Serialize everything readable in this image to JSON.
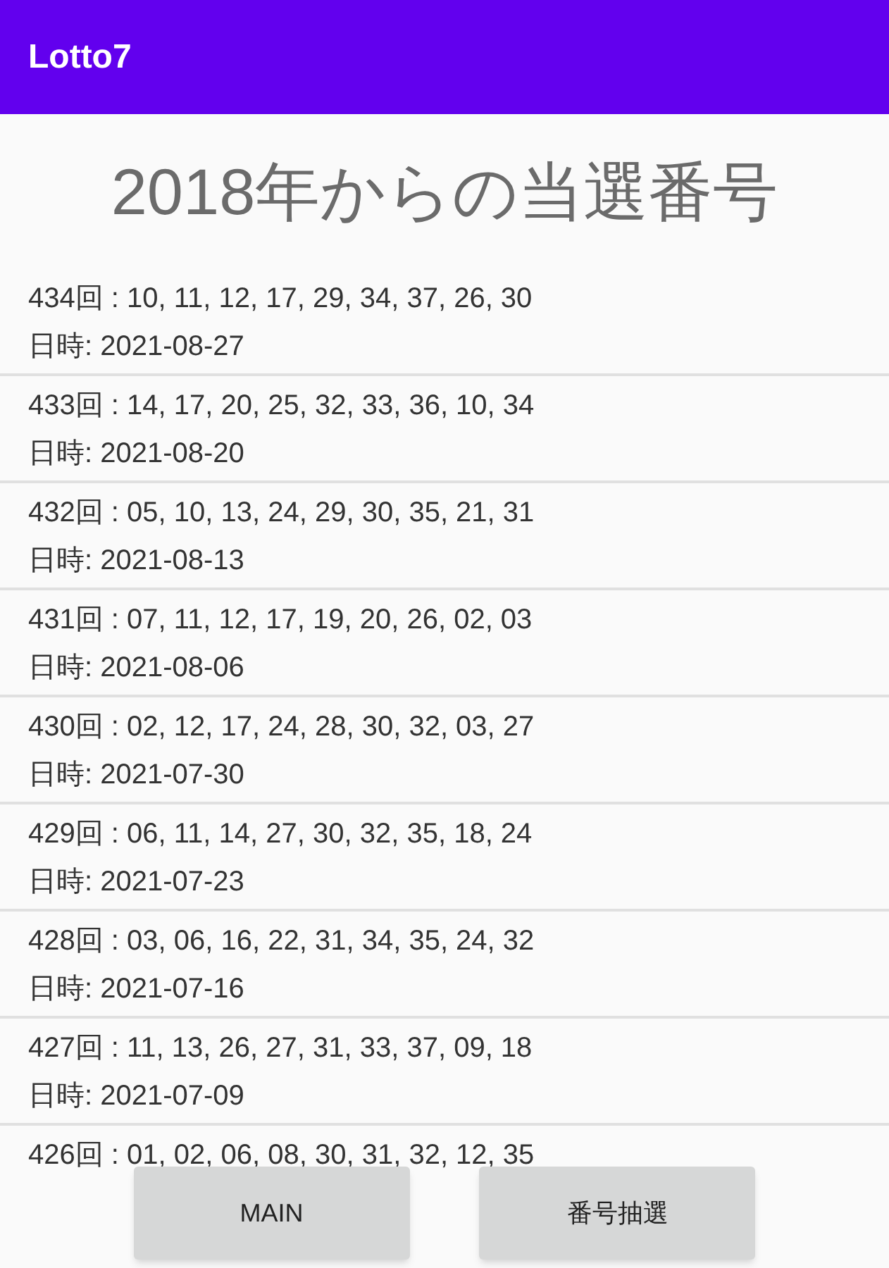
{
  "app_bar": {
    "title": "Lotto7"
  },
  "heading": "2018年からの当選番号",
  "draws": [
    {
      "numbers": "434回 : 10, 11, 12, 17, 29, 34, 37, 26, 30",
      "date": "日時: 2021-08-27"
    },
    {
      "numbers": "433回 : 14, 17, 20, 25, 32, 33, 36, 10, 34",
      "date": "日時: 2021-08-20"
    },
    {
      "numbers": "432回 : 05, 10, 13, 24, 29, 30, 35, 21, 31",
      "date": "日時: 2021-08-13"
    },
    {
      "numbers": "431回 : 07, 11, 12, 17, 19, 20, 26, 02, 03",
      "date": "日時: 2021-08-06"
    },
    {
      "numbers": "430回 : 02, 12, 17, 24, 28, 30, 32, 03, 27",
      "date": "日時: 2021-07-30"
    },
    {
      "numbers": "429回 : 06, 11, 14, 27, 30, 32, 35, 18, 24",
      "date": "日時: 2021-07-23"
    },
    {
      "numbers": "428回 : 03, 06, 16, 22, 31, 34, 35, 24, 32",
      "date": "日時: 2021-07-16"
    },
    {
      "numbers": "427回 : 11, 13, 26, 27, 31, 33, 37, 09, 18",
      "date": "日時: 2021-07-09"
    },
    {
      "numbers": "426回 : 01, 02, 06, 08, 30, 31, 32, 12, 35"
    }
  ],
  "buttons": [
    "MAIN",
    "番号抽選"
  ]
}
